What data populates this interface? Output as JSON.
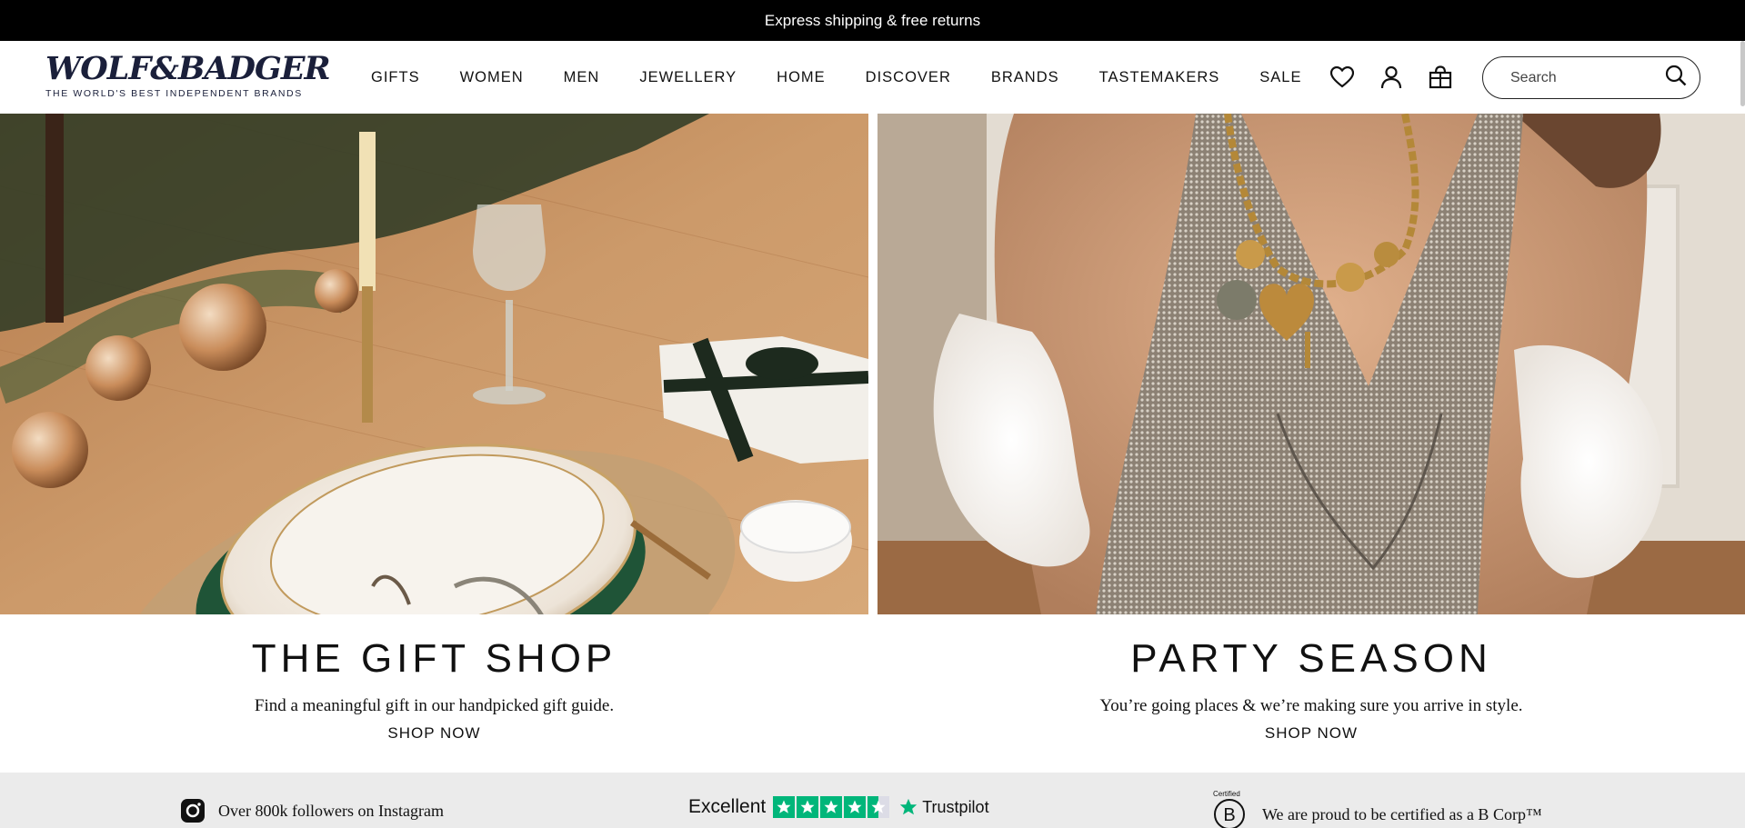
{
  "announcement": "Express shipping & free returns",
  "logo": {
    "main": "WOLF&BADGER",
    "tagline": "THE WORLD'S BEST INDEPENDENT BRANDS"
  },
  "nav": [
    "GIFTS",
    "WOMEN",
    "MEN",
    "JEWELLERY",
    "HOME",
    "DISCOVER",
    "BRANDS",
    "TASTEMAKERS",
    "SALE"
  ],
  "header_icons": [
    "heart-icon",
    "account-icon",
    "gift-bag-icon"
  ],
  "search": {
    "placeholder": "Search"
  },
  "promos": [
    {
      "title": "THE GIFT SHOP",
      "subtitle": "Find a meaningful gift in our handpicked gift guide.",
      "cta": "SHOP NOW"
    },
    {
      "title": "PARTY SEASON",
      "subtitle": "You’re going places & we’re making sure you arrive in style.",
      "cta": "SHOP NOW"
    }
  ],
  "trust_strip": {
    "instagram": "Over 800k followers on Instagram",
    "trustpilot_rating": "Excellent",
    "trustpilot_stars": 4.5,
    "trustpilot_brand": "Trustpilot",
    "bcorp_certified": "Certified",
    "bcorp_text": "We are proud to be certified as a B Corp™"
  },
  "colors": {
    "announcement_bg": "#000000",
    "logo_navy": "#1a1f3a",
    "trustpilot_green": "#00b67a",
    "strip_bg": "#ebebeb"
  }
}
